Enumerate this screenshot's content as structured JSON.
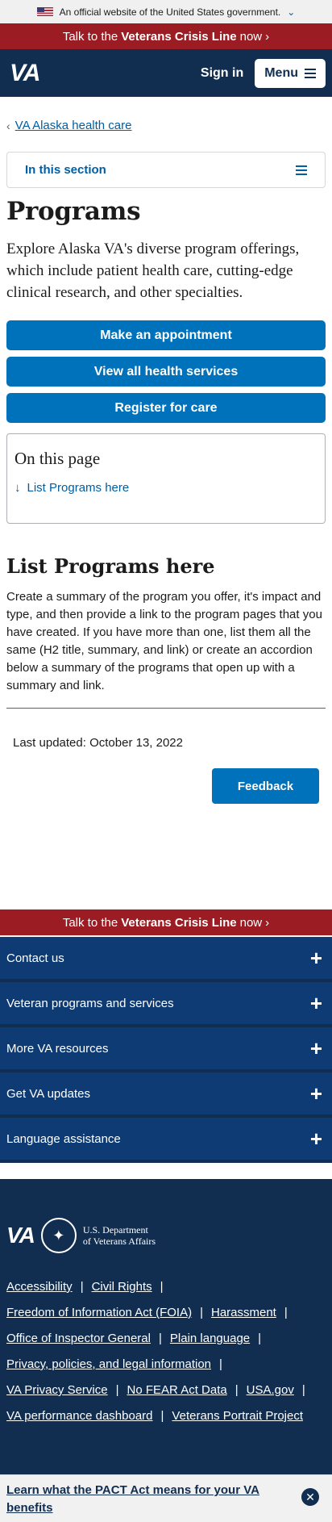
{
  "gov_banner": {
    "text": "An official website of the United States government."
  },
  "crisis": {
    "prefix": "Talk to the",
    "bold": "Veterans Crisis Line",
    "suffix": "now"
  },
  "header": {
    "logo": "VA",
    "signin": "Sign in",
    "menu": "Menu"
  },
  "breadcrumb": {
    "label": "VA Alaska health care"
  },
  "in_section": {
    "label": "In this section"
  },
  "page": {
    "title": "Programs",
    "intro": "Explore Alaska VA's diverse program offerings, which include patient health care, cutting-edge clinical research, and other specialties."
  },
  "ctas": [
    "Make an appointment",
    "View all health services",
    "Register for care"
  ],
  "on_this_page": {
    "title": "On this page",
    "link": "List Programs here"
  },
  "section": {
    "title": "List Programs here",
    "body": "Create a summary of the program you offer, it's impact and type, and then provide a link to the program pages that you have created.  If you have more than one, list them all the same (H2 title, summary, and link) or create an accordion below a summary of the programs that open up with a summary and link."
  },
  "last_updated": "Last updated: October 13, 2022",
  "feedback": "Feedback",
  "footer_crisis": {
    "prefix": "Talk to the",
    "bold": "Veterans Crisis Line",
    "suffix": "now"
  },
  "footer_accordion": [
    "Contact us",
    "Veteran programs and services",
    "More VA resources",
    "Get VA updates",
    "Language assistance"
  ],
  "footer": {
    "logo": "VA",
    "dept_line1": "U.S. Department",
    "dept_line2": "of Veterans Affairs",
    "links": [
      [
        "Accessibility",
        "Civil Rights"
      ],
      [
        "Freedom of Information Act (FOIA)",
        "Harassment"
      ],
      [
        "Office of Inspector General",
        "Plain language"
      ],
      [
        "Privacy, policies, and legal information"
      ],
      [
        "VA Privacy Service",
        "No FEAR Act Data",
        "USA.gov"
      ],
      [
        "VA performance dashboard",
        "Veterans Portrait Project"
      ]
    ]
  },
  "pact": {
    "text": "Learn what the PACT Act means for your VA benefits"
  },
  "colors": {
    "header": "#112e51",
    "crisis": "#9b1c23",
    "primary": "#0071bb",
    "link": "#005ea2"
  }
}
